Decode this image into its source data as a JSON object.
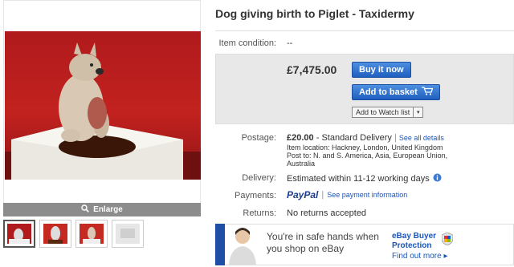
{
  "listing": {
    "title": "Dog giving birth to Piglet - Taxidermy"
  },
  "gallery": {
    "enlarge_label": "Enlarge",
    "thumbnail_count": 4
  },
  "item_condition": {
    "label": "Item condition:",
    "value": "--"
  },
  "buy": {
    "price": "£7,475.00",
    "buy_now_label": "Buy it now",
    "add_to_basket_label": "Add to basket",
    "watch_label": "Add to Watch list"
  },
  "postage": {
    "label": "Postage:",
    "cost": "£20.00",
    "method": "- Standard Delivery",
    "see_all": "See all details",
    "item_location": "Item location: Hackney, London, United Kingdom",
    "post_to": "Post to: N. and S. America, Asia, European Union,",
    "post_to_cont": "Australia"
  },
  "delivery": {
    "label": "Delivery:",
    "value": "Estimated within 11-12 working days"
  },
  "payments": {
    "label": "Payments:",
    "paypal": "PayPal",
    "see_info": "See payment information"
  },
  "returns": {
    "label": "Returns:",
    "value": "No returns accepted"
  },
  "protection": {
    "line1": "You're in safe hands when",
    "line2": "you shop on eBay",
    "title_line1": "eBay Buyer",
    "title_line2": "Protection",
    "more": "Find out more ▸"
  },
  "colors": {
    "link": "#1a56b8",
    "button_blue": "#1f5fbf",
    "photo_red": "#b01a1c"
  }
}
